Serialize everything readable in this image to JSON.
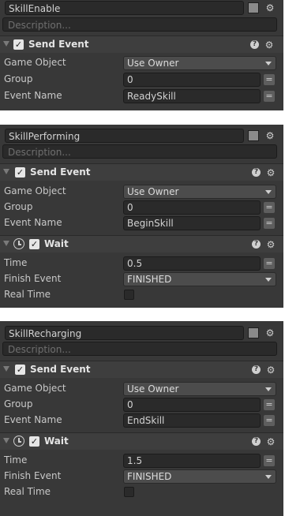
{
  "panels": [
    {
      "state_name": "SkillEnable",
      "description_placeholder": "Description...",
      "send_event": {
        "title": "Send Event",
        "game_object_label": "Game Object",
        "game_object_value": "Use Owner",
        "group_label": "Group",
        "group_value": "0",
        "event_name_label": "Event Name",
        "event_name_value": "ReadySkill"
      }
    },
    {
      "state_name": "SkillPerforming",
      "description_placeholder": "Description...",
      "send_event": {
        "title": "Send Event",
        "game_object_label": "Game Object",
        "game_object_value": "Use Owner",
        "group_label": "Group",
        "group_value": "0",
        "event_name_label": "Event Name",
        "event_name_value": "BeginSkill"
      },
      "wait": {
        "title": "Wait",
        "time_label": "Time",
        "time_value": "0.5",
        "finish_event_label": "Finish Event",
        "finish_event_value": "FINISHED",
        "real_time_label": "Real Time"
      }
    },
    {
      "state_name": "SkillRecharging",
      "description_placeholder": "Description...",
      "send_event": {
        "title": "Send Event",
        "game_object_label": "Game Object",
        "game_object_value": "Use Owner",
        "group_label": "Group",
        "group_value": "0",
        "event_name_label": "Event Name",
        "event_name_value": "EndSkill"
      },
      "wait": {
        "title": "Wait",
        "time_label": "Time",
        "time_value": "1.5",
        "finish_event_label": "Finish Event",
        "finish_event_value": "FINISHED",
        "real_time_label": "Real Time"
      }
    }
  ],
  "icons": {
    "checkbox_glyph": "✓",
    "help_glyph": "?",
    "gear_glyph": "⚙",
    "equals_glyph": "="
  }
}
